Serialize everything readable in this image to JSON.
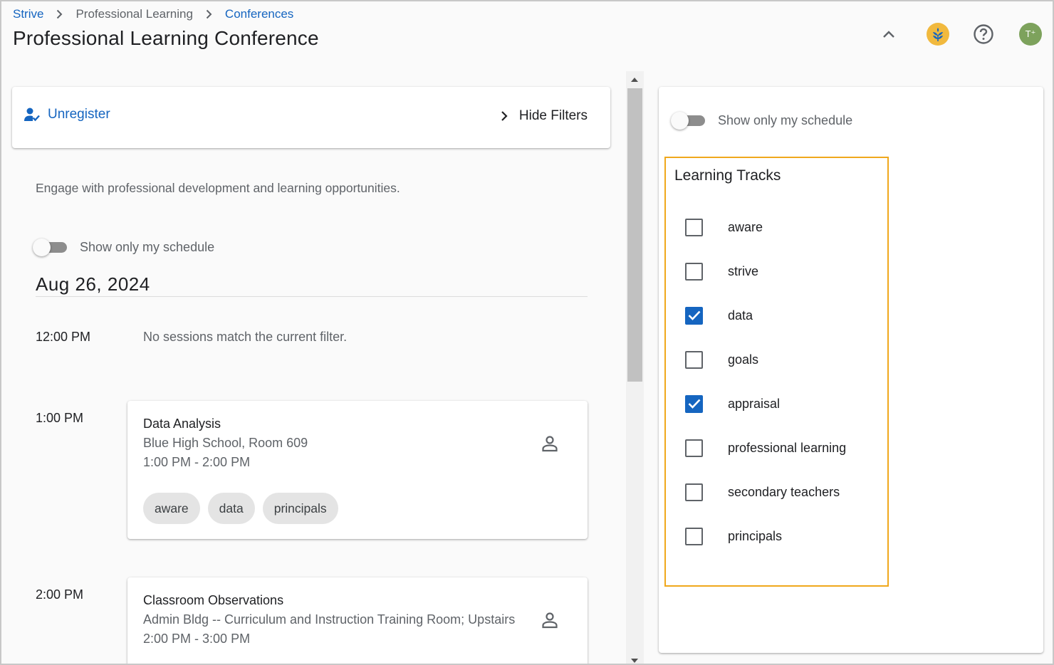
{
  "breadcrumb": {
    "items": [
      {
        "label": "Strive",
        "link": true
      },
      {
        "label": "Professional Learning",
        "link": false
      },
      {
        "label": "Conferences",
        "link": true
      }
    ]
  },
  "page_title": "Professional Learning Conference",
  "header_icons": {
    "collapse": "chevron-up-icon",
    "logo": "strive-logo-icon",
    "help": "help-circle-icon",
    "avatar_initials": "T⁺"
  },
  "actions": {
    "unregister_label": "Unregister",
    "hide_filters_label": "Hide Filters"
  },
  "description": "Engage with professional development and learning opportunities.",
  "schedule_toggle": {
    "label": "Show only my schedule",
    "on": false
  },
  "date_heading": "Aug 26, 2024",
  "timeslots": [
    {
      "time": "12:00 PM",
      "empty_message": "No sessions match the current filter."
    },
    {
      "time": "1:00 PM"
    },
    {
      "time": "2:00 PM"
    }
  ],
  "sessions": [
    {
      "title": "Data Analysis",
      "location": "Blue High School, Room 609",
      "time_range": "1:00 PM - 2:00 PM",
      "tags": [
        "aware",
        "data",
        "principals"
      ]
    },
    {
      "title": "Classroom Observations",
      "location": "Admin Bldg -- Curriculum and Instruction Training Room; Upstairs",
      "time_range": "2:00 PM - 3:00 PM",
      "tags": []
    }
  ],
  "filters": {
    "schedule_toggle_label": "Show only my schedule",
    "schedule_toggle_on": false,
    "tracks_title": "Learning Tracks",
    "tracks": [
      {
        "label": "aware",
        "checked": false
      },
      {
        "label": "strive",
        "checked": false
      },
      {
        "label": "data",
        "checked": true
      },
      {
        "label": "goals",
        "checked": false
      },
      {
        "label": "appraisal",
        "checked": true
      },
      {
        "label": "professional learning",
        "checked": false
      },
      {
        "label": "secondary teachers",
        "checked": false
      },
      {
        "label": "principals",
        "checked": false
      }
    ]
  },
  "colors": {
    "accent": "#1565c0",
    "highlight_border": "#f0a81c",
    "avatar": "#7da25c",
    "logo": "#f1b93e"
  }
}
